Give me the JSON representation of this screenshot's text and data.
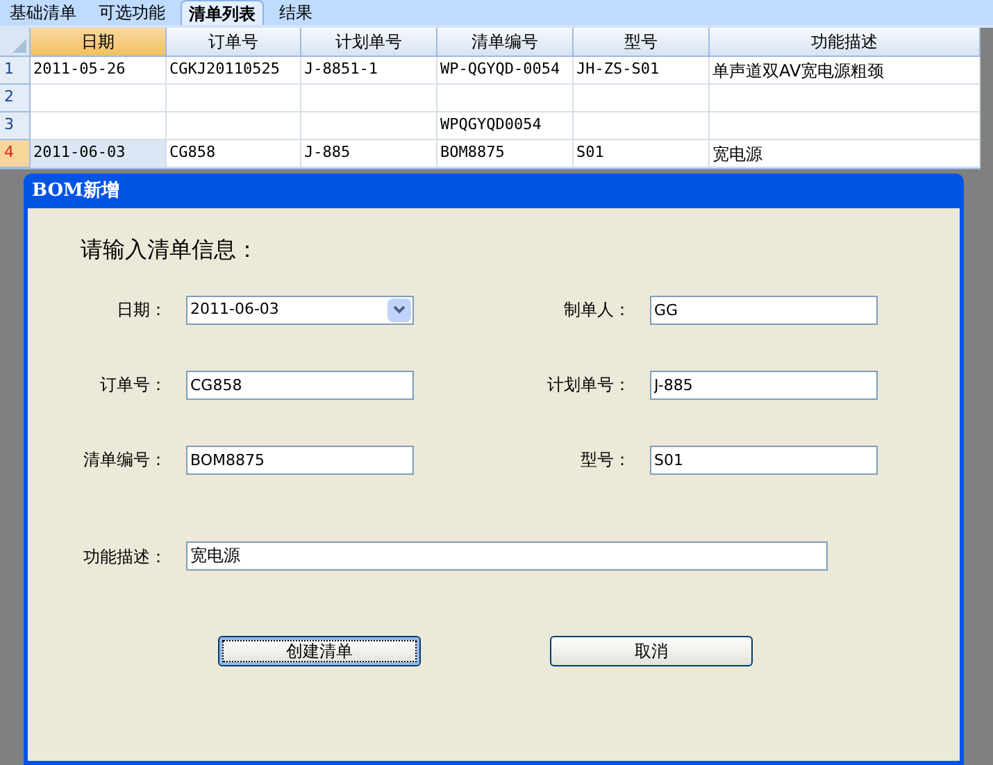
{
  "tabs": [
    {
      "label": "基础清单",
      "selected": false
    },
    {
      "label": "可选功能",
      "selected": false
    },
    {
      "label": "清单列表",
      "selected": true
    },
    {
      "label": "结果",
      "selected": false
    }
  ],
  "table": {
    "columns": [
      {
        "label": "日期",
        "selected": true
      },
      {
        "label": "订单号",
        "selected": false
      },
      {
        "label": "计划单号",
        "selected": false
      },
      {
        "label": "清单编号",
        "selected": false
      },
      {
        "label": "型号",
        "selected": false
      },
      {
        "label": "功能描述",
        "selected": false
      }
    ],
    "rows": [
      {
        "number": "1",
        "selected": false,
        "cells": [
          "2011-05-26",
          "CGKJ20110525",
          "J-8851-1",
          "WP-QGYQD-0054",
          "JH-ZS-S01",
          "单声道双AV宽电源粗颈"
        ]
      },
      {
        "number": "2",
        "selected": false,
        "cells": [
          "",
          "",
          "",
          "",
          "",
          ""
        ]
      },
      {
        "number": "3",
        "selected": false,
        "cells": [
          "",
          "",
          "",
          "WPQGYQD0054",
          "",
          ""
        ]
      },
      {
        "number": "4",
        "selected": true,
        "cells": [
          "2011-06-03",
          "CG858",
          "J-885",
          "BOM8875",
          "S01",
          "宽电源"
        ]
      }
    ]
  },
  "dialog": {
    "title": "BOM新增",
    "heading": "请输入清单信息：",
    "fields": [
      {
        "label": "日期：",
        "value": "2011-06-03",
        "kind": "dropdown"
      },
      {
        "label": "制单人：",
        "value": "GG",
        "kind": "text"
      },
      {
        "label": "订单号：",
        "value": "CG858",
        "kind": "text"
      },
      {
        "label": "计划单号：",
        "value": "J-885",
        "kind": "text"
      },
      {
        "label": "清单编号：",
        "value": "BOM8875",
        "kind": "text"
      },
      {
        "label": "型号：",
        "value": "S01",
        "kind": "text"
      }
    ],
    "description": {
      "label": "功能描述：",
      "value": "宽电源"
    },
    "buttons": [
      {
        "label": "创建清单",
        "focused": true
      },
      {
        "label": "取消",
        "focused": false
      }
    ]
  }
}
